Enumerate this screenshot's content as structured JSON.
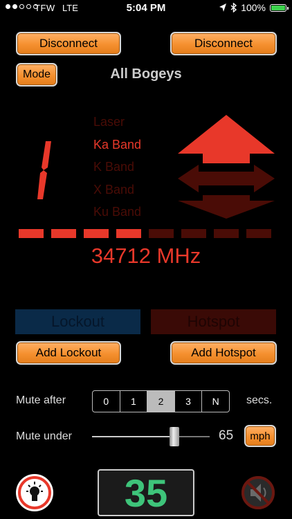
{
  "status_bar": {
    "signal_dots": [
      true,
      true,
      false,
      false,
      false
    ],
    "carrier": "TFW",
    "network": "LTE",
    "time": "5:04 PM",
    "battery_text": "100%",
    "battery_level": 1.0
  },
  "header": {
    "disconnect_left": "Disconnect",
    "disconnect_right": "Disconnect",
    "mode_label": "Mode",
    "mode_value": "All Bogeys"
  },
  "display": {
    "bogey_count": "1",
    "bands": [
      {
        "label": "Laser",
        "active": false
      },
      {
        "label": "Ka Band",
        "active": true
      },
      {
        "label": "K Band",
        "active": false
      },
      {
        "label": "X Band",
        "active": false
      },
      {
        "label": "Ku Band",
        "active": false
      }
    ],
    "direction": {
      "front": true,
      "side": false,
      "rear": false
    },
    "signal_strength_bars": 4,
    "signal_strength_max": 8,
    "frequency": "34712 MHz"
  },
  "zones": {
    "lockout_label": "Lockout",
    "hotspot_label": "Hotspot",
    "add_lockout": "Add Lockout",
    "add_hotspot": "Add Hotspot"
  },
  "mute": {
    "after_label": "Mute after",
    "after_options": [
      "0",
      "1",
      "2",
      "3",
      "N"
    ],
    "after_selected": "2",
    "after_unit": "secs.",
    "under_label": "Mute under",
    "under_value": "65",
    "under_fraction": 0.72,
    "unit_button": "mph"
  },
  "footer": {
    "speed": "35"
  },
  "colors": {
    "accent_red": "#e8382a",
    "dim_red": "#4a0c06",
    "orange_button": "#f5902f",
    "speed_green": "#3ec47a"
  }
}
